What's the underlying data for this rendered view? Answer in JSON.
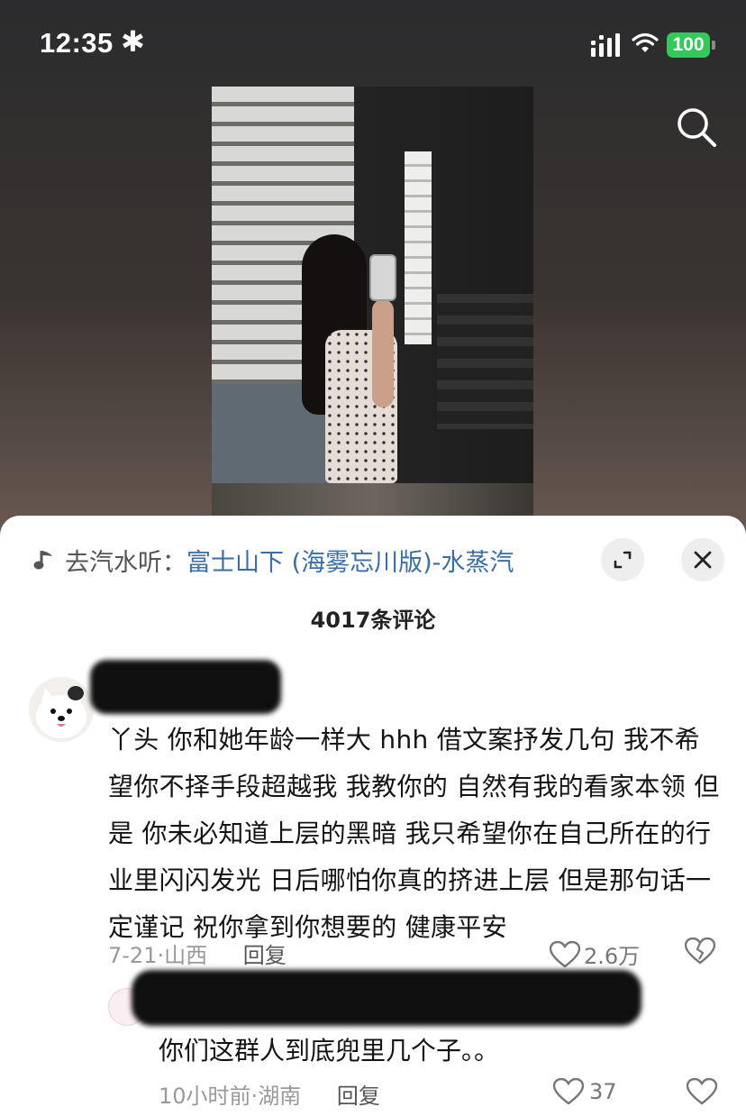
{
  "status_bar": {
    "time": "12:35",
    "indicator": "✱",
    "battery": "100",
    "icons": [
      "signal-icon",
      "wifi-icon",
      "battery-icon"
    ]
  },
  "header": {
    "icon": "search-icon"
  },
  "post": {
    "image_icon": "post-photo"
  },
  "music": {
    "prefix": "去汽水听：",
    "title": "富士山下 (海雾忘川版)-水蒸汽",
    "icon": "music-note-icon"
  },
  "comments_panel": {
    "count_label": "4017条评论",
    "expand_icon": "expand-icon",
    "close_icon": "close-icon"
  },
  "comment": {
    "text": "丫头 你和她年龄一样大 hhh 借文案抒发几句 我不希望你不择手段超越我 我教你的 自然有我的看家本领 但是 你未必知道上层的黑暗 我只希望你在自己所在的行业里闪闪发光 日后哪怕你真的挤进上层 但是那句话一定谨记 祝你拿到你想要的 健康平安",
    "date": "7-21",
    "separator": "·",
    "location": "山西",
    "reply_label": "回复",
    "likes": "2.6万",
    "colors": {
      "meta": "#999999",
      "text": "#141414"
    }
  },
  "reply": {
    "text": "你们这群人到底兜里几个子。。",
    "time": "10小时前",
    "separator": "·",
    "location": "湖南",
    "reply_label": "回复",
    "likes": "37"
  },
  "colors": {
    "music_title": "#3a6ea5",
    "battery": "#34c759"
  }
}
